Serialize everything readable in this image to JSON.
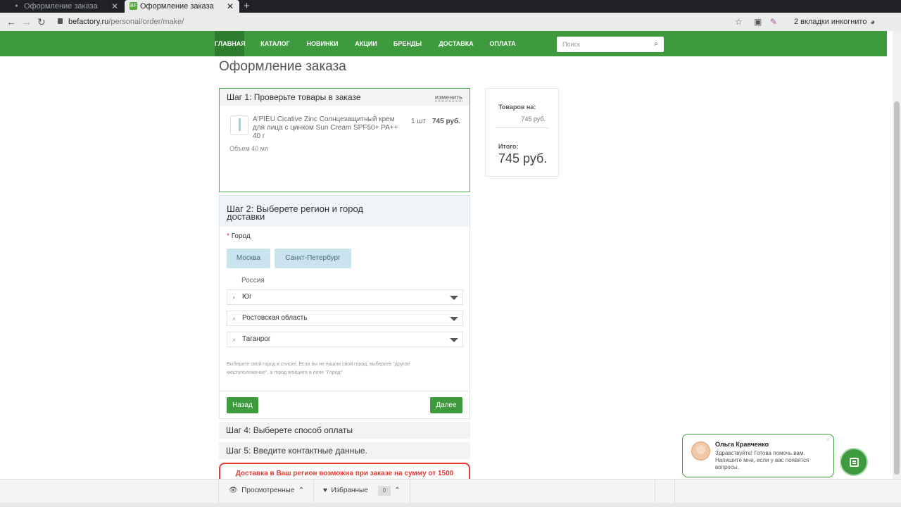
{
  "browser": {
    "tabs": [
      {
        "title": "Оформление заказа",
        "active": false
      },
      {
        "title": "Оформление заказа",
        "active": true
      }
    ],
    "url_domain": "befactory.ru",
    "url_path": "/personal/order/make/",
    "incognito_text": "2 вкладки инкогнито"
  },
  "nav": {
    "items": [
      "ГЛАВНАЯ",
      "КАТАЛОГ",
      "НОВИНКИ",
      "АКЦИИ",
      "БРЕНДЫ",
      "ДОСТАВКА",
      "ОПЛАТА"
    ],
    "active_index": 0,
    "search_placeholder": "Поиск"
  },
  "page_title": "Оформление заказа",
  "step1": {
    "title": "Шаг 1: Проверьте товары в заказе",
    "change_link": "изменить",
    "product": {
      "name": "A'PIEU Cicative Zinc Солнцезащитный крем для лица с цинком Sun Cream SPF50+ PA++ 40 г",
      "qty": "1 шт",
      "price": "745 руб.",
      "volume": "Объем 40 мл"
    }
  },
  "summary": {
    "items_label": "Товаров на:",
    "items_value": "745 руб.",
    "total_label": "Итого:",
    "total_value": "745 руб."
  },
  "step2": {
    "title_line1": "Шаг 2: Выберете регион и город",
    "title_line2": "доставки",
    "city_label": "Город",
    "city_buttons": [
      "Москва",
      "Санкт-Петербург"
    ],
    "country": "Россия",
    "selects": [
      "Юг",
      "Ростовская область",
      "Таганрог"
    ],
    "hint": "Выберите свой город в списке. Если вы не нашли свой город, выберите \"другое местоположение\", а город впишите в поле \"Город\"",
    "back_button": "Назад",
    "next_button": "Далее"
  },
  "step4_title": "Шаг 4: Выберете способ оплаты",
  "step5_title": "Шаг 5: Введите контактные данные.",
  "warning": "Доставка в Ваш регион возможна при заказе на сумму от 1500",
  "chat": {
    "name": "Ольга Кравченко",
    "message": "Здравствуйте! Готова помочь вам. Напишите мне, если у вас появятся вопросы.",
    "close": "×"
  },
  "bottom": {
    "viewed_label": "Просмотренные",
    "favorites_label": "Избранные",
    "favorites_count": "0"
  },
  "colors": {
    "brand_green": "#3d9a3d",
    "active_nav": "#2e7d2e",
    "warning_red": "#e53935",
    "city_button_bg": "#c9e4ee"
  }
}
